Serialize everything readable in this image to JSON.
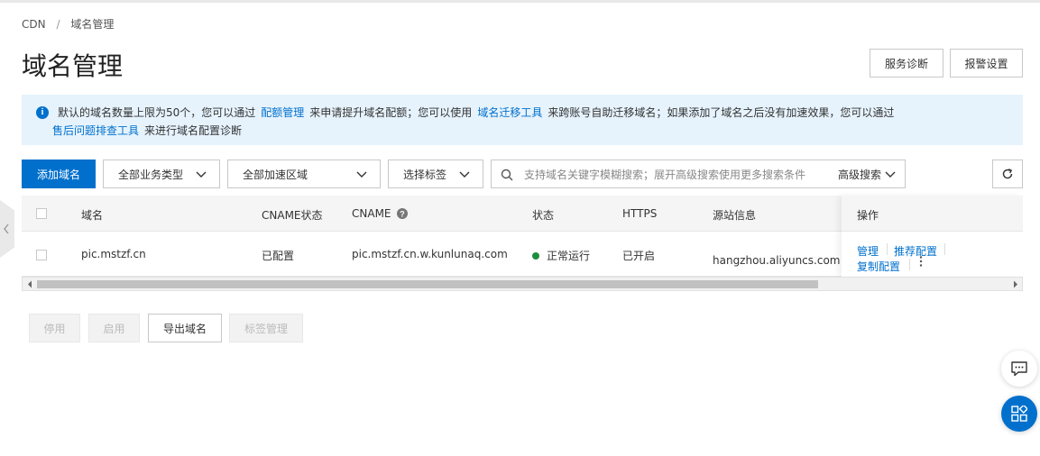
{
  "breadcrumb": {
    "root": "CDN",
    "separator": "/",
    "current": "域名管理"
  },
  "page": {
    "title": "域名管理"
  },
  "header_buttons": {
    "diagnose": "服务诊断",
    "alarm": "报警设置"
  },
  "notice": {
    "text1": "默认的域名数量上限为50个，您可以通过",
    "link1": "配额管理",
    "text2": "来申请提升域名配额；您可以使用",
    "link2": "域名迁移工具",
    "text3": "来跨账号自助迁移域名；如果添加了域名之后没有加速效果，您可以通过",
    "link3": "售后问题排查工具",
    "text4": "来进行域名配置诊断"
  },
  "toolbar": {
    "add_domain": "添加域名",
    "business_type": "全部业务类型",
    "region": "全部加速区域",
    "tags": "选择标签",
    "search_placeholder": "支持域名关键字模糊搜索；展开高级搜索使用更多搜索条件",
    "advanced_search": "高级搜索"
  },
  "table": {
    "headers": {
      "domain": "域名",
      "cname_status": "CNAME状态",
      "cname": "CNAME",
      "status": "状态",
      "https": "HTTPS",
      "origin": "源站信息",
      "actions": "操作"
    },
    "rows": [
      {
        "domain": "pic.mstzf.cn",
        "cname_status": "已配置",
        "cname": "pic.mstzf.cn.w.kunlunaq.com",
        "status": "正常运行",
        "https": "已开启",
        "origin": "hangzhou.aliyuncs.com",
        "actions": {
          "manage": "管理",
          "recommend": "推荐配置",
          "copy": "复制配置"
        }
      }
    ]
  },
  "bottom_buttons": {
    "disable": "停用",
    "enable": "启用",
    "export": "导出域名",
    "tag_manage": "标签管理"
  },
  "colors": {
    "primary": "#0070cc",
    "notice_bg": "#e6f3fd",
    "status_ok": "#1e8e3e"
  }
}
